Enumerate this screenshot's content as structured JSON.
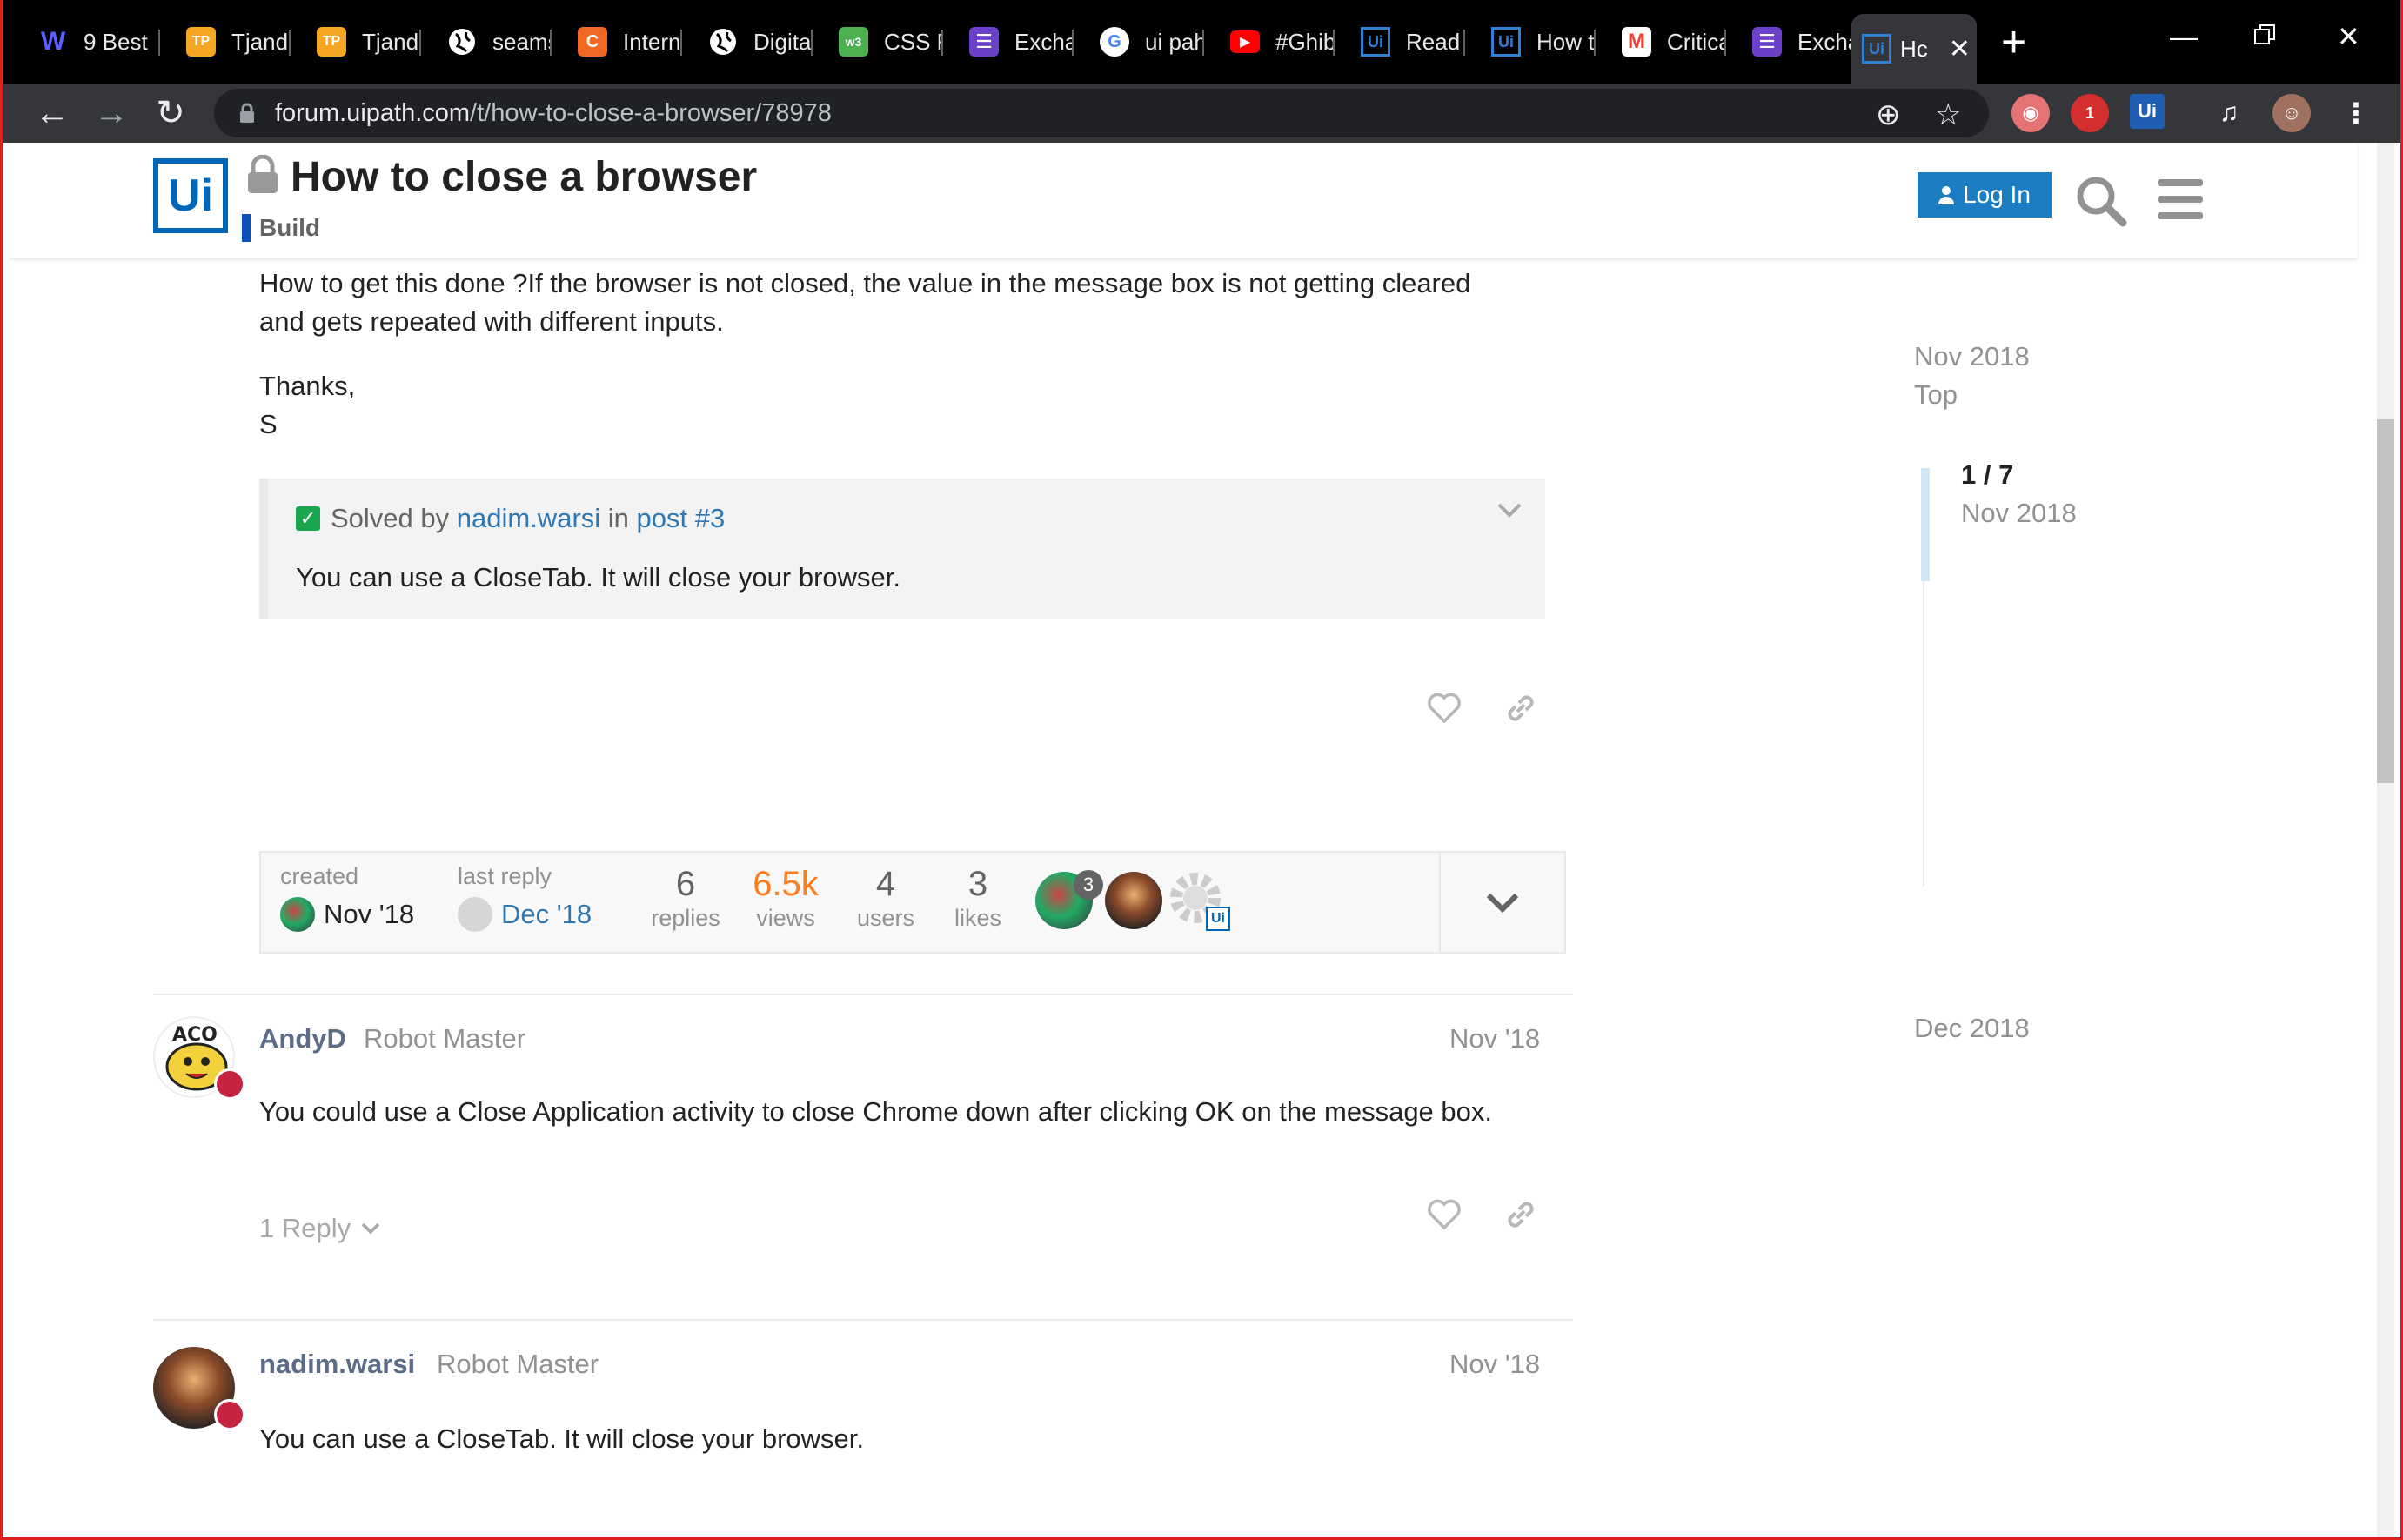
{
  "browser": {
    "tabs": [
      {
        "label": "9 Best",
        "icon": "w-logo-icon",
        "color": "#5b5fff"
      },
      {
        "label": "Tjandr",
        "icon": "tp-icon",
        "color": "#f5a623"
      },
      {
        "label": "Tjandr",
        "icon": "tp-icon",
        "color": "#f5a623"
      },
      {
        "label": "seams",
        "icon": "globe-icon",
        "color": "#ffffff"
      },
      {
        "label": "Intern",
        "icon": "c-icon",
        "color": "#f26722"
      },
      {
        "label": "Digita",
        "icon": "globe-icon",
        "color": "#ffffff"
      },
      {
        "label": "CSS R",
        "icon": "css-icon",
        "color": "#4caf50"
      },
      {
        "label": "Exchar",
        "icon": "list-icon",
        "color": "#6a41c8"
      },
      {
        "label": "ui pah",
        "icon": "google-icon",
        "color": "#ffffff"
      },
      {
        "label": "#Ghib",
        "icon": "youtube-icon",
        "color": "#ff0000"
      },
      {
        "label": "Read (",
        "icon": "ui-icon",
        "color": "#0067b8"
      },
      {
        "label": "How t",
        "icon": "ui-icon",
        "color": "#0067b8"
      },
      {
        "label": "Critica",
        "icon": "gmail-icon",
        "color": "#ea4335"
      },
      {
        "label": "Excha",
        "icon": "list-icon",
        "color": "#6a41c8"
      },
      {
        "label": "Hc",
        "icon": "ui-icon",
        "color": "#0067b8"
      }
    ],
    "url_domain": "forum.uipath.com",
    "url_path": "/t/how-to-close-a-browser/78978"
  },
  "header": {
    "logo_text": "Ui",
    "title": "How to close a browser",
    "category": "Build",
    "login_label": "Log In"
  },
  "first_post": {
    "body_line1": "How to get this done ?If the browser is not closed, the value in the message box is not getting cleared",
    "body_line2": "and gets repeated with different inputs.",
    "thanks": "Thanks,",
    "signature": "S",
    "solved": {
      "prefix": "Solved by",
      "user": "nadim.warsi",
      "in": "in",
      "post_link": "post #3",
      "quote": "You can use a CloseTab. It will close your browser."
    }
  },
  "topic_map": {
    "created_label": "created",
    "created_date": "Nov '18",
    "last_reply_label": "last reply",
    "last_reply_date": "Dec '18",
    "stats": [
      {
        "num": "6",
        "label": "replies"
      },
      {
        "num": "6.5k",
        "label": "views"
      },
      {
        "num": "4",
        "label": "users"
      },
      {
        "num": "3",
        "label": "likes"
      }
    ],
    "participant_count": "3",
    "participant_logo": "Ui"
  },
  "posts": [
    {
      "username": "AndyD",
      "title": "Robot Master",
      "date": "Nov '18",
      "body": "You could use a Close Application activity to close Chrome down after clicking OK on the message box.",
      "replies": "1 Reply",
      "avatar_text": "ACO"
    },
    {
      "username": "nadim.warsi",
      "title": "Robot Master",
      "date": "Nov '18",
      "body": "You can use a CloseTab. It will close your browser."
    }
  ],
  "timeline": {
    "start": "Nov 2018",
    "top": "Top",
    "position": "1 / 7",
    "position_date": "Nov 2018",
    "end": "Dec 2018"
  },
  "extensions": {
    "badge_count": "1",
    "ui_label": "Ui"
  }
}
